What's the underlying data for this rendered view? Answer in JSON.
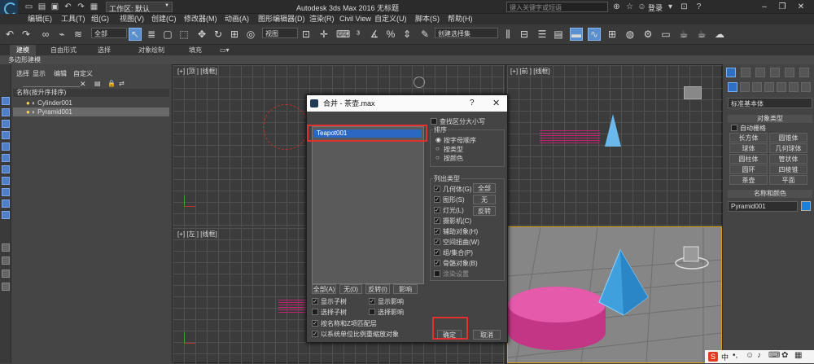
{
  "titlebar": {
    "logo_text": "MAX",
    "workspace": "工作区: 默认",
    "title": "Autodesk 3ds Max 2016    无标题",
    "search_placeholder": "键入关键字或短语",
    "login": "登录"
  },
  "menu": [
    "编辑(E)",
    "工具(T)",
    "组(G)",
    "视图(V)",
    "创建(C)",
    "修改器(M)",
    "动画(A)",
    "图形编辑器(D)",
    "渲染(R)",
    "Civil View",
    "自定义(U)",
    "脚本(S)",
    "帮助(H)"
  ],
  "toolbar": {
    "selection_filter": "全部",
    "ref_coord": "视图",
    "named_sel": "创建选择集"
  },
  "ribbon": {
    "tabs": [
      "建模",
      "自由形式",
      "选择",
      "对象绘制",
      "填充"
    ],
    "sub": "多边形建模"
  },
  "scene": {
    "menus": [
      "选择",
      "显示",
      "编辑",
      "自定义"
    ],
    "header": "名称(按升序排序)",
    "rows": [
      "Cylinder001",
      "Pyramid001"
    ]
  },
  "viewports": {
    "top": "[+] [顶 ] [线框]",
    "front": "[+] [前 ] [线框]",
    "left": "[+] [左 ] [线框]"
  },
  "command_panel": {
    "dropdown": "标准基本体",
    "object_type": "对象类型",
    "autogrid": "自动栅格",
    "buttons": [
      "长方体",
      "圆锥体",
      "球体",
      "几何球体",
      "圆柱体",
      "管状体",
      "圆环",
      "四棱锥",
      "茶壶",
      "平面"
    ],
    "name_color": "名称和颜色",
    "object_name": "Pyramid001"
  },
  "dialog": {
    "title": "合并 - 茶壶.max",
    "list_items": [
      "Teapot001"
    ],
    "case_sensitive": "查找区分大小写",
    "sort_title": "排序",
    "sort_options": [
      "按字母顺序",
      "按类型",
      "按颜色"
    ],
    "list_types_title": "列出类型",
    "types": [
      "几何体(G)",
      "图形(S)",
      "灯光(L)",
      "摄影机(C)",
      "辅助对象(H)",
      "空间扭曲(W)",
      "组/集合(P)",
      "骨骼对象(B)"
    ],
    "xref": "涂染设置",
    "type_buttons": [
      "全部",
      "无",
      "反转"
    ],
    "list_buttons": [
      "全部(A)",
      "无(0)",
      "反转(I)",
      "影响"
    ],
    "subtree_options": [
      "显示子树",
      "显示影响",
      "选择子树",
      "选择影响"
    ],
    "match_option": "按名称和Z项匹配层",
    "units_option": "以系统单位比例重缩放对象",
    "ok": "确定",
    "cancel": "取消"
  },
  "taskbar": {
    "ime": "中"
  }
}
